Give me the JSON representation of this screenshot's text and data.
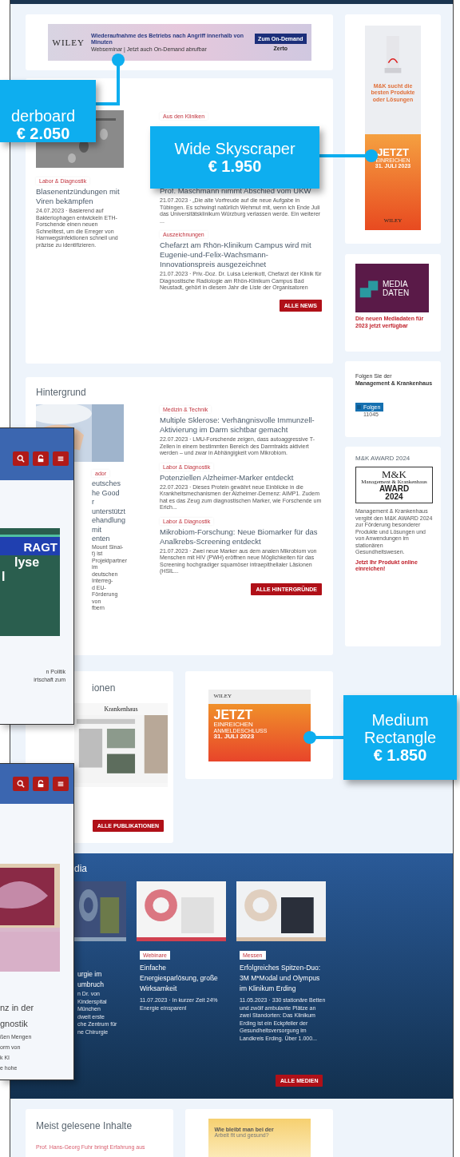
{
  "leaderboard_ad": {
    "brand": "WILEY",
    "headline": "Wiederaufnahme des Betriebs nach Angriff innerhalb von Minuten",
    "subline": "Webseminar | Jetzt auch On-Demand abrufbar",
    "button": "Zum On-Demand",
    "partner": "Zerto"
  },
  "news": {
    "left": {
      "tag": "Labor & Diagnostik",
      "title": "Blasenentzündungen mit Viren bekämpfen",
      "excerpt": "24.07.2023 · Basierend auf Bakteriophagen entwickeln ETH-Forschende einen neuen Schnelltest, um die Erreger von Harnwegsinfektionen schnell und präzise zu identifizieren."
    },
    "top_tag": "Aus den Kliniken",
    "articles": [
      {
        "title": "Prof. Maschmann nimmt Abschied vom UKW",
        "excerpt": "21.07.2023 · „Die alte Vorfreude auf die neue Aufgabe in Tübingen. Es schwingt natürlich Wehmut mit, wenn ich Ende Juli das Universitätsklinikum Würzburg verlassen werde. Ein weiterer ..."
      },
      {
        "tag": "Auszeichnungen",
        "title": "Chefarzt am Rhön-Klinikum Campus wird mit Eugenie-und-Felix-Wachsmann-Innovationspreis ausgezeichnet",
        "excerpt": "21.07.2023 · Priv.-Doz. Dr. Luisa Leienkott, Chefarzt der Klinik für Diagnostische Radiologie am Rhön-Klinikum Campus Bad Neustadt, gehört in diesem Jahr die Liste der Organisatoren"
      }
    ],
    "button": "ALLE NEWS"
  },
  "background_section": {
    "heading": "Hintergrund",
    "left_tag": "ador",
    "left_title_lines": [
      "eutsches",
      "he Good",
      "r unterstützt",
      "ehandlung mit",
      "enten"
    ],
    "left_excerpt_lines": [
      "Mount Sinai-",
      "t) ist Projektpartner im",
      "deutschen Interreg-",
      "d EU-Förderung von",
      "fbern"
    ],
    "articles": [
      {
        "tag": "Medizin & Technik",
        "title": "Multiple Sklerose: Verhängnisvolle Immunzell-Aktivierung im Darm sichtbar gemacht",
        "excerpt": "22.07.2023 · LMU-Forschende zeigen, dass autoaggressive T-Zellen in einem bestimmten Bereich des Darmtrakts aktiviert werden – und zwar in Abhängigkeit vom Mikrobiom."
      },
      {
        "tag": "Labor & Diagnostik",
        "title": "Potenziellen Alzheimer-Marker entdeckt",
        "excerpt": "22.07.2023 · Dieses Protein gewährt neue Einblicke in die Krankheitsmechanismen der Alzheimer-Demenz: AIMP1. Zudem hat es das Zeug zum diagnostischen Marker, wie Forschende um Erich..."
      },
      {
        "tag": "Labor & Diagnostik",
        "title": "Mikrobiom-Forschung: Neue Biomarker für das Analkrebs-Screening entdeckt",
        "excerpt": "21.07.2023 · Zwei neue Marker aus dem analen Mikrobiom von Menschen mit HIV (PWH) eröffnen neue Möglichkeiten für das Screening hochgradiger squamöser intraepithelialer Läsionen (HSIL..."
      }
    ],
    "button": "ALLE HINTERGRÜNDE"
  },
  "publications": {
    "heading": "ionen",
    "magazine_title": "Krankenhaus",
    "button": "ALLE PUBLIKATIONEN"
  },
  "medium_rectangle_ad": {
    "brand": "WILEY",
    "cta": "JETZT",
    "cta_sub": "EINREICHEN",
    "deadline_label": "ANMELDESCHLUSS",
    "deadline": "31. JULI 2023"
  },
  "media": {
    "heading": "dia",
    "items": [
      {
        "title_lines": [
          "urgie im",
          "umbruch"
        ],
        "excerpt_lines": [
          "n Dr. von",
          "Kinderspital München",
          "dweit erste",
          "che Zentrum für",
          "ne Chirurgie"
        ]
      },
      {
        "tag": "Webinare",
        "title": "Einfache Energiesparlösung, große Wirksamkeit",
        "excerpt": "11.07.2023 · In kurzer Zeit 24% Energie einsparen!"
      },
      {
        "tag": "Messen",
        "title": "Erfolgreiches Spitzen-Duo: 3M M*Modal und Olympus im Klinikum Erding",
        "excerpt": "11.05.2023 · 330 stationäre Betten und zwölf ambulante Plätze an zwei Standorten: Das Klinikum Erding ist ein Eckpfeiler der Gesundheitsversorgung im Landkreis Erding. Über 1.000..."
      }
    ],
    "button": "ALLE MEDIEN"
  },
  "most_read": {
    "heading": "Meist gelesene Inhalte",
    "first": "Prof. Hans-Georg Fuhr bringt Erfahrung aus"
  },
  "bottom_ad": {
    "headline": "Wie bleibt man bei der",
    "subline": "Arbeit fit und gesund?"
  },
  "sidebar": {
    "skyscraper_ad": {
      "claim": "M&K sucht die besten Produkte oder Lösungen",
      "cta": "JETZT",
      "cta_sub": "EINREICHEN",
      "deadline": "31. JULI 2023",
      "brand": "WILEY"
    },
    "mediadaten": {
      "logo_lines": [
        "MEDIA",
        "DATEN"
      ],
      "caption": "Die neuen Mediadaten für 2023 jetzt verfügbar"
    },
    "follow": {
      "text_lines": [
        "Folgen Sie der",
        "Management & Krankenhaus"
      ],
      "button": "Folgen",
      "count": "11045"
    },
    "award": {
      "heading": "M&K AWARD 2024",
      "logo_top": "M&K",
      "logo_mid": "Management & Krankenhaus",
      "logo_award": "AWARD",
      "logo_year": "2024",
      "text": "Management & Krankenhaus vergibt den M&K AWARD 2024 zur Förderung besonderer Produkte und Lösungen und von Anwendungen im stationären Gesundheitswesen.",
      "link": "Jetzt Ihr Produkt online einreichen!"
    }
  },
  "phone_views": [
    {
      "ad_lines": [
        "RAGT",
        "lyse",
        "l"
      ],
      "text_lines": [
        "n Politik",
        "irtschaft zum"
      ]
    },
    {
      "text_lines": [
        "nz in der",
        "gnostik",
        "ßen Mengen",
        "orm von",
        "k KI",
        "e hohe"
      ]
    }
  ],
  "callouts": [
    {
      "name": "derboard",
      "price": "€ 2.050"
    },
    {
      "name": "Wide Skyscraper",
      "price": "€ 1.950"
    },
    {
      "name": "Medium Rectangle",
      "price": "€ 1.850"
    }
  ]
}
